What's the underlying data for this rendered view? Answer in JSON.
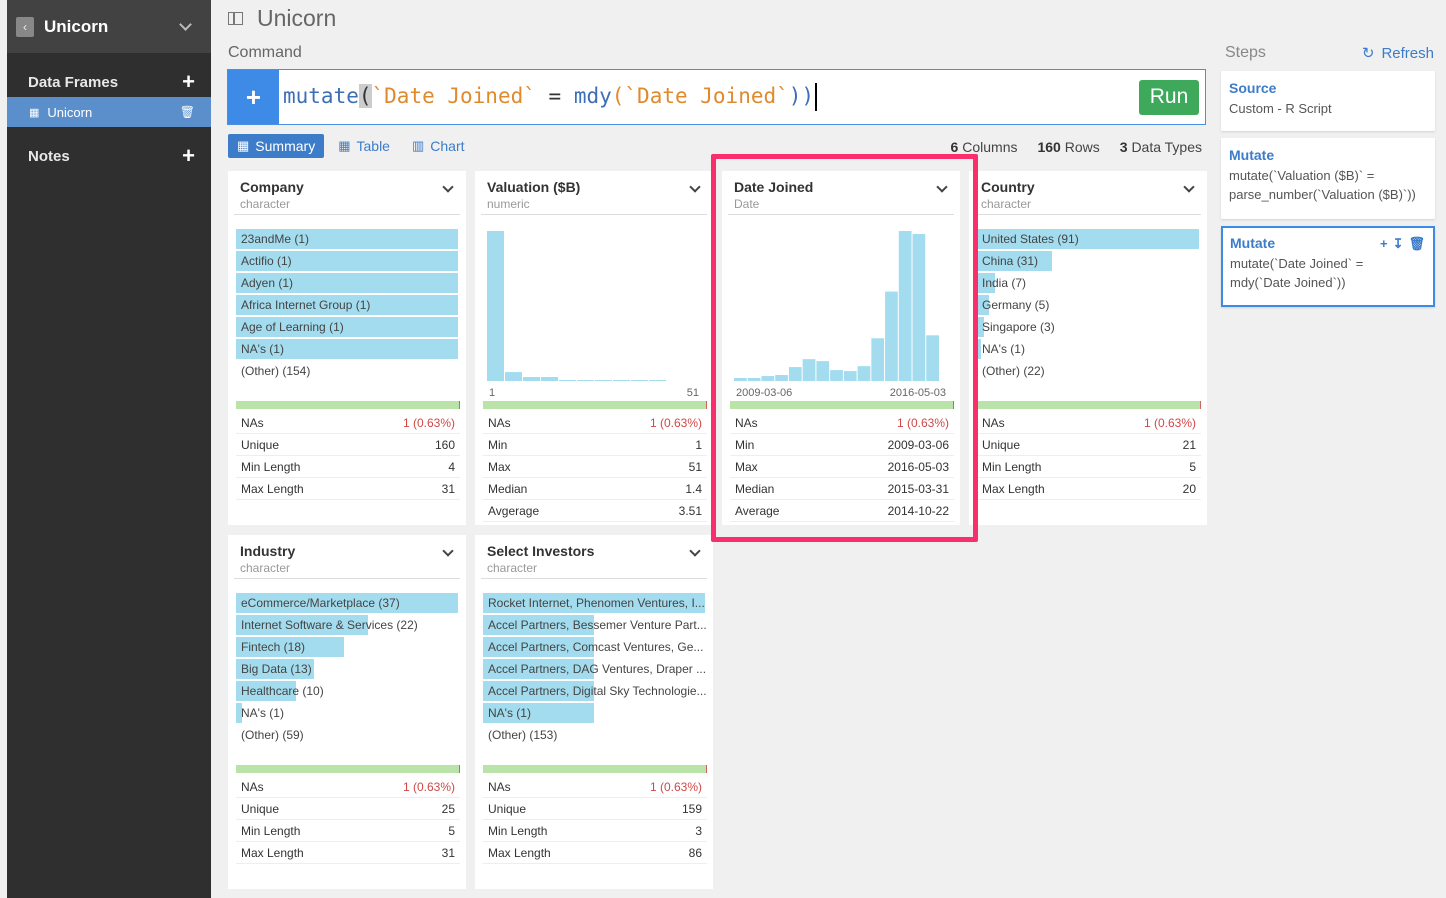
{
  "sidebar": {
    "project": "Unicorn",
    "data_frames_label": "Data Frames",
    "df_items": [
      {
        "label": "Unicorn"
      }
    ],
    "notes_label": "Notes"
  },
  "header": {
    "title": "Unicorn",
    "command_label": "Command"
  },
  "command": {
    "fn1": "mutate",
    "open_paren": "(",
    "arg1": "`Date Joined`",
    "eq": " = ",
    "fn2": "mdy",
    "arg2": "(`Date Joined`",
    "close": "))",
    "run_label": "Run"
  },
  "tabs": [
    {
      "label": "Summary",
      "icon": "summary-icon"
    },
    {
      "label": "Table",
      "icon": "table-icon"
    },
    {
      "label": "Chart",
      "icon": "chart-icon"
    }
  ],
  "stats": {
    "columns_n": "6",
    "columns_label": "Columns",
    "rows_n": "160",
    "rows_label": "Rows",
    "types_n": "3",
    "types_label": "Data Types"
  },
  "cards": {
    "company": {
      "title": "Company",
      "type": "character",
      "items": [
        {
          "label": "23andMe (1)",
          "frac": 1.0
        },
        {
          "label": "Actifio (1)",
          "frac": 1.0
        },
        {
          "label": "Adyen (1)",
          "frac": 1.0
        },
        {
          "label": "Africa Internet Group (1)",
          "frac": 1.0
        },
        {
          "label": "Age of Learning (1)",
          "frac": 1.0
        },
        {
          "label": "NA's (1)",
          "frac": 1.0
        },
        {
          "label": "(Other) (154)",
          "frac": 0
        }
      ],
      "stats": [
        {
          "k": "NAs",
          "v": "1 (0.63%)",
          "red": true
        },
        {
          "k": "Unique",
          "v": "160"
        },
        {
          "k": "Min Length",
          "v": "4"
        },
        {
          "k": "Max Length",
          "v": "31"
        }
      ]
    },
    "valuation": {
      "title": "Valuation ($B)",
      "type": "numeric",
      "hist_min_label": "1",
      "hist_max_label": "51",
      "stats": [
        {
          "k": "NAs",
          "v": "1 (0.63%)",
          "red": true
        },
        {
          "k": "Min",
          "v": "1"
        },
        {
          "k": "Max",
          "v": "51"
        },
        {
          "k": "Median",
          "v": "1.4"
        },
        {
          "k": "Avgerage",
          "v": "3.51"
        }
      ]
    },
    "date_joined": {
      "title": "Date Joined",
      "type": "Date",
      "hist_min_label": "2009-03-06",
      "hist_max_label": "2016-05-03",
      "stats": [
        {
          "k": "NAs",
          "v": "1 (0.63%)",
          "red": true
        },
        {
          "k": "Min",
          "v": "2009-03-06"
        },
        {
          "k": "Max",
          "v": "2016-05-03"
        },
        {
          "k": "Median",
          "v": "2015-03-31"
        },
        {
          "k": "Average",
          "v": "2014-10-22"
        }
      ]
    },
    "country": {
      "title": "Country",
      "type": "character",
      "items": [
        {
          "label": "United States (91)",
          "frac": 1.0
        },
        {
          "label": "China (31)",
          "frac": 0.34
        },
        {
          "label": "India (7)",
          "frac": 0.08
        },
        {
          "label": "Germany (5)",
          "frac": 0.055
        },
        {
          "label": "Singapore (3)",
          "frac": 0.033
        },
        {
          "label": "NA's (1)",
          "frac": 0.011
        },
        {
          "label": "(Other) (22)",
          "frac": 0
        }
      ],
      "stats": [
        {
          "k": "NAs",
          "v": "1 (0.63%)",
          "red": true
        },
        {
          "k": "Unique",
          "v": "21"
        },
        {
          "k": "Min Length",
          "v": "5"
        },
        {
          "k": "Max Length",
          "v": "20"
        }
      ]
    },
    "industry": {
      "title": "Industry",
      "type": "character",
      "items": [
        {
          "label": "eCommerce/Marketplace (37)",
          "frac": 1.0
        },
        {
          "label": "Internet Software & Services (22)",
          "frac": 0.595
        },
        {
          "label": "Fintech (18)",
          "frac": 0.486
        },
        {
          "label": "Big Data (13)",
          "frac": 0.351
        },
        {
          "label": "Healthcare (10)",
          "frac": 0.27
        },
        {
          "label": "NA's (1)",
          "frac": 0.027
        },
        {
          "label": "(Other) (59)",
          "frac": 0
        }
      ],
      "stats": [
        {
          "k": "NAs",
          "v": "1 (0.63%)",
          "red": true
        },
        {
          "k": "Unique",
          "v": "25"
        },
        {
          "k": "Min Length",
          "v": "5"
        },
        {
          "k": "Max Length",
          "v": "31"
        }
      ]
    },
    "investors": {
      "title": "Select Investors",
      "type": "character",
      "items": [
        {
          "label": "Rocket Internet, Phenomen Ventures, I...",
          "frac": 1.0
        },
        {
          "label": "Accel Partners, Bessemer Venture Part...",
          "frac": 0.5
        },
        {
          "label": "Accel Partners, Comcast Ventures, Ge...",
          "frac": 0.5
        },
        {
          "label": "Accel Partners, DAG Ventures, Draper ...",
          "frac": 0.5
        },
        {
          "label": "Accel Partners, Digital Sky Technologie...",
          "frac": 0.5
        },
        {
          "label": "NA's (1)",
          "frac": 0.5
        },
        {
          "label": "(Other) (153)",
          "frac": 0
        }
      ],
      "stats": [
        {
          "k": "NAs",
          "v": "1 (0.63%)",
          "red": true
        },
        {
          "k": "Unique",
          "v": "159"
        },
        {
          "k": "Min Length",
          "v": "3"
        },
        {
          "k": "Max Length",
          "v": "86"
        }
      ]
    }
  },
  "histograms": {
    "valuation": [
      151,
      9,
      4,
      4,
      1,
      1,
      1,
      1,
      1,
      1
    ],
    "date_joined": [
      3,
      3,
      5,
      6,
      14,
      22,
      20,
      11,
      10,
      15,
      43,
      90,
      151,
      148,
      46
    ]
  },
  "steps": {
    "label": "Steps",
    "refresh_label": "Refresh",
    "items": [
      {
        "title": "Source",
        "body": "Custom - R Script"
      },
      {
        "title": "Mutate",
        "body": "mutate(`Valuation ($B)` = parse_number(`Valuation ($B)`))"
      },
      {
        "title": "Mutate",
        "body": "mutate(`Date Joined` = mdy(`Date Joined`))"
      }
    ]
  },
  "colors": {
    "bar": "#a3dcee",
    "accent": "#3d7cc9",
    "highlight": "#fb2e6d",
    "run": "#3fa95b"
  }
}
